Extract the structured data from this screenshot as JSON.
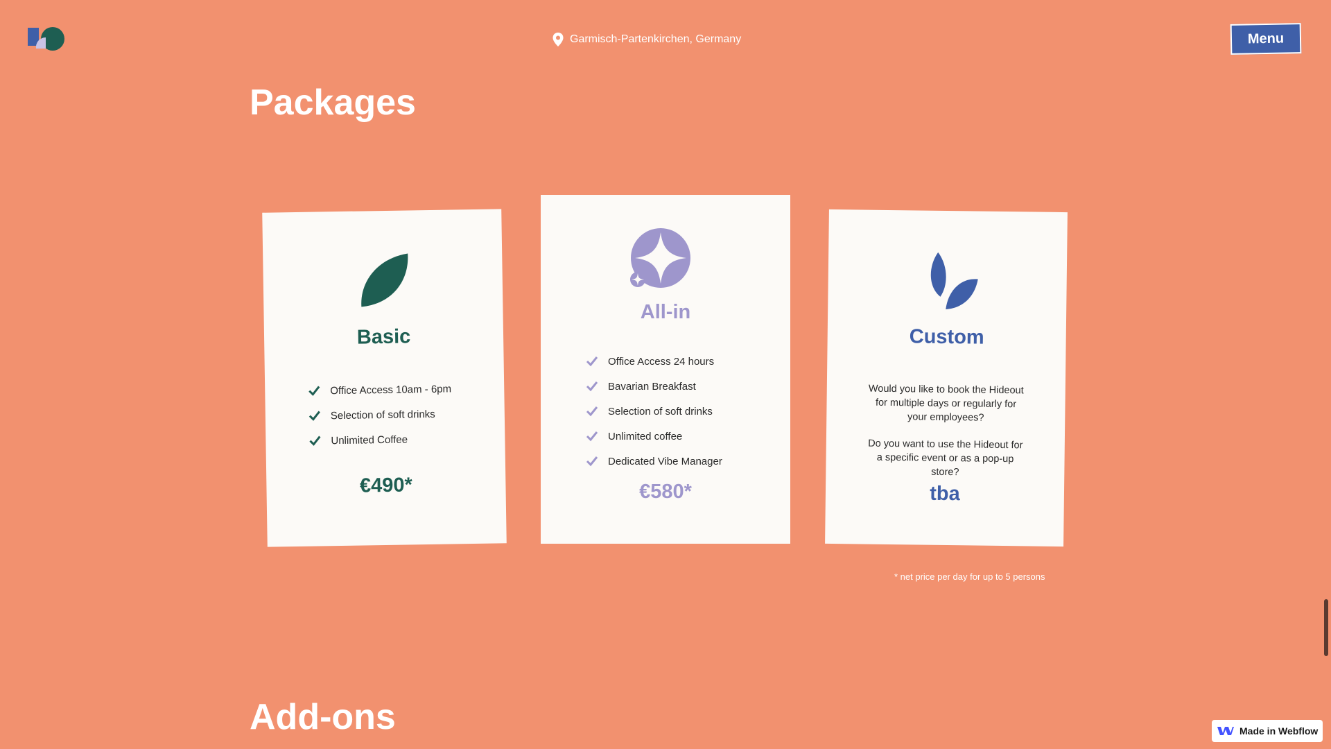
{
  "header": {
    "location": "Garmisch-Partenkirchen, Germany",
    "menu_label": "Menu"
  },
  "sections": {
    "packages_title": "Packages",
    "addons_title": "Add-ons"
  },
  "packages": {
    "basic": {
      "title": "Basic",
      "features": [
        "Office Access 10am - 6pm",
        "Selection of soft drinks",
        "Unlimited Coffee"
      ],
      "price": "€490*",
      "color": "#1E5E52",
      "icon": "leaf-icon"
    },
    "allin": {
      "title": "All-in",
      "features": [
        "Office Access 24 hours",
        "Bavarian Breakfast",
        "Selection of soft drinks",
        "Unlimited coffee",
        "Dedicated Vibe Manager"
      ],
      "price": "€580*",
      "color": "#9E96CC",
      "icon": "sparkle-icon"
    },
    "custom": {
      "title": "Custom",
      "description_1": "Would you like to book the Hideout for multiple days or regularly for your employees?",
      "description_2": "Do you want to use the Hideout for a specific event or as a pop-up store?",
      "price": "tba",
      "color": "#3F5FA8",
      "icon": "sprout-icon"
    }
  },
  "footnote": "* net price per day for up to 5 persons",
  "badge": {
    "label": "Made in Webflow",
    "icon": "webflow-logo-icon"
  },
  "colors": {
    "background": "#F2916F",
    "menu_button": "#3F5FA8",
    "card": "#FCFAF7"
  }
}
